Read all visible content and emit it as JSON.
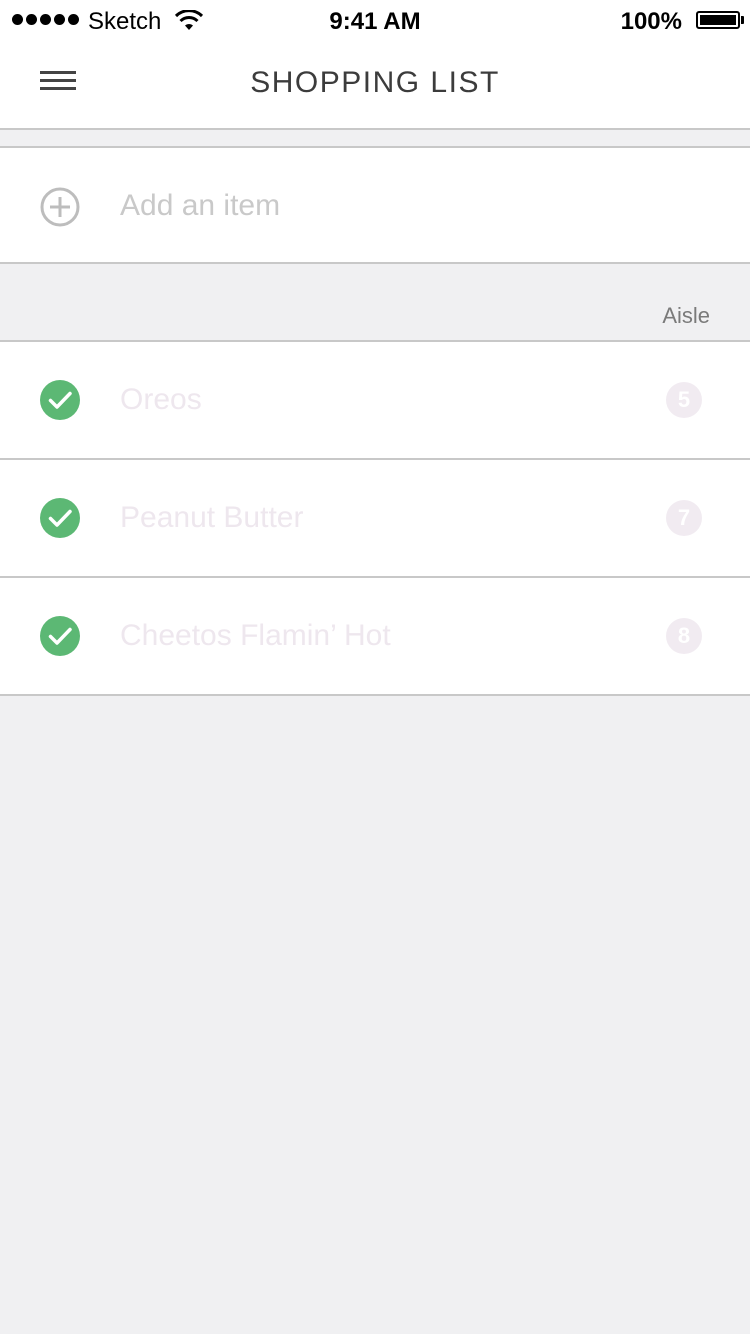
{
  "status_bar": {
    "carrier": "Sketch",
    "time": "9:41 AM",
    "battery_percent": "100%",
    "signal_icon": "signal-dots-icon",
    "wifi_icon": "wifi-icon",
    "battery_icon": "battery-icon"
  },
  "nav": {
    "title": "SHOPPING LIST",
    "menu_icon": "hamburger-menu-icon"
  },
  "add_item": {
    "placeholder": "Add an item",
    "value": "",
    "icon": "plus-circle-icon"
  },
  "list": {
    "column_header": "Aisle",
    "items": [
      {
        "name": "Oreos",
        "aisle": "5",
        "checked": true
      },
      {
        "name": "Peanut Butter",
        "aisle": "7",
        "checked": true
      },
      {
        "name": "Cheetos Flamin’ Hot",
        "aisle": "8",
        "checked": true
      }
    ]
  },
  "colors": {
    "check_green": "#5cb874",
    "background": "#f0f0f2",
    "divider": "#c8c8c8",
    "checked_text": "#eee7ee",
    "aisle_badge": "#f1ebf1"
  }
}
